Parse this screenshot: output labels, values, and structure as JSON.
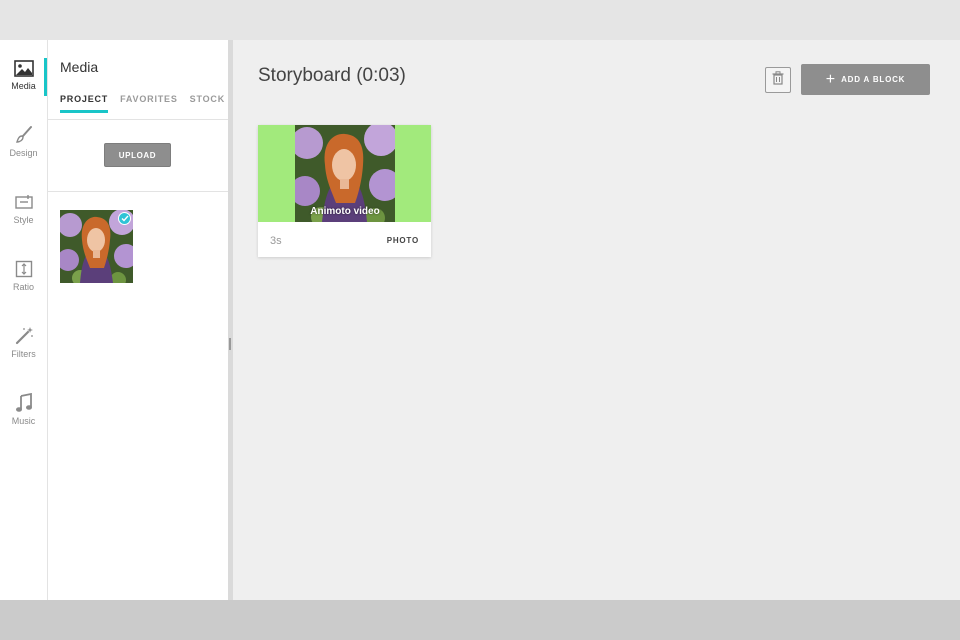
{
  "sidebar": {
    "items": [
      {
        "label": "Media",
        "icon": "image-icon",
        "active": true
      },
      {
        "label": "Design",
        "icon": "brush-icon"
      },
      {
        "label": "Style",
        "icon": "style-icon"
      },
      {
        "label": "Ratio",
        "icon": "ratio-icon"
      },
      {
        "label": "Filters",
        "icon": "magic-wand-icon"
      },
      {
        "label": "Music",
        "icon": "music-note-icon"
      }
    ]
  },
  "panel": {
    "title": "Media",
    "tabs": [
      {
        "label": "PROJECT",
        "active": true
      },
      {
        "label": "FAVORITES"
      },
      {
        "label": "STOCK"
      }
    ],
    "upload_label": "UPLOAD",
    "items": [
      {
        "type": "photo",
        "selected": true
      }
    ]
  },
  "storyboard": {
    "title": "Storyboard (0:03)",
    "add_label": "ADD A BLOCK",
    "blocks": [
      {
        "duration": "3s",
        "type": "PHOTO",
        "watermark": "Animoto video"
      }
    ]
  },
  "colors": {
    "accent": "#19c5c8",
    "block_background": "#a2ea7c",
    "button_gray": "#8e8e8e"
  }
}
